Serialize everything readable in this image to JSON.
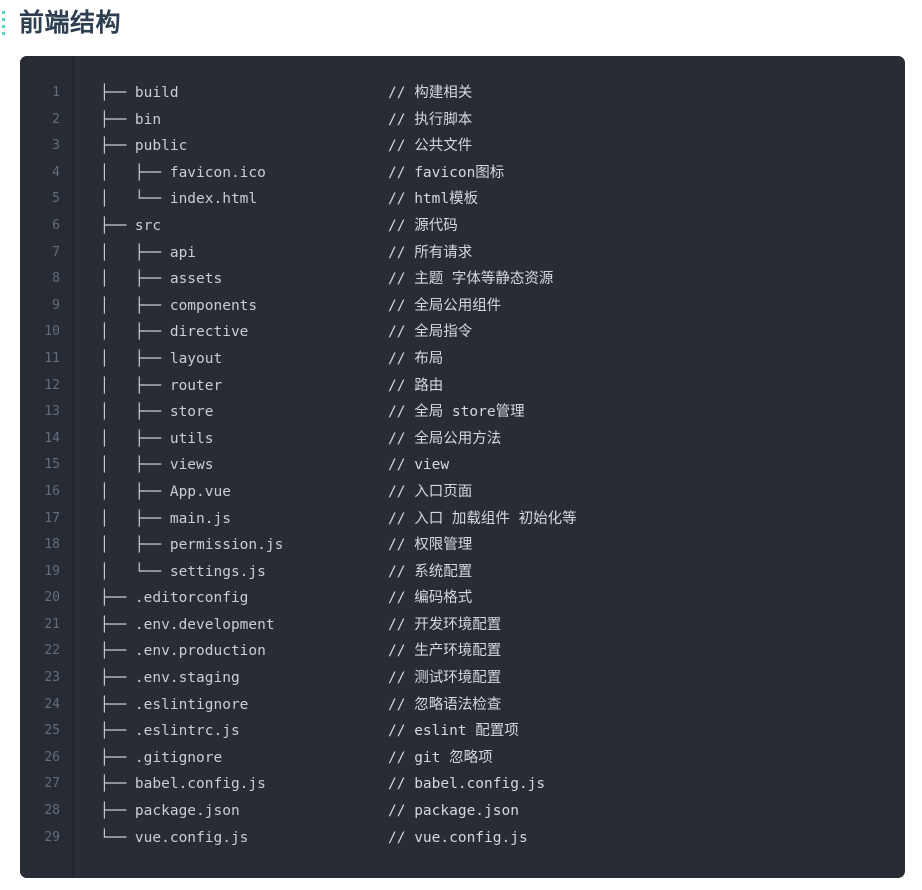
{
  "heading": {
    "title": "前端结构",
    "anchor_marker": "anchor-dots"
  },
  "colors": {
    "page_background": "#ffffff",
    "heading_text": "#2c3e50",
    "code_background": "#282c34",
    "gutter_background": "#272b33",
    "gutter_divider": "#21242b",
    "line_number": "#636d7d",
    "code_text": "#c8cdd6",
    "comment_text": "#d3d8e0",
    "anchor_marker": "#3ec9c9"
  },
  "code_block": {
    "language": "text",
    "total_lines": 29,
    "lines": [
      {
        "n": "1",
        "tree": "├── build",
        "comment": "// 构建相关"
      },
      {
        "n": "2",
        "tree": "├── bin",
        "comment": "// 执行脚本"
      },
      {
        "n": "3",
        "tree": "├── public",
        "comment": "// 公共文件"
      },
      {
        "n": "4",
        "tree": "│   ├── favicon.ico",
        "comment": "// favicon图标"
      },
      {
        "n": "5",
        "tree": "│   └── index.html",
        "comment": "// html模板"
      },
      {
        "n": "6",
        "tree": "├── src",
        "comment": "// 源代码"
      },
      {
        "n": "7",
        "tree": "│   ├── api",
        "comment": "// 所有请求"
      },
      {
        "n": "8",
        "tree": "│   ├── assets",
        "comment": "// 主题 字体等静态资源"
      },
      {
        "n": "9",
        "tree": "│   ├── components",
        "comment": "// 全局公用组件"
      },
      {
        "n": "10",
        "tree": "│   ├── directive",
        "comment": "// 全局指令"
      },
      {
        "n": "11",
        "tree": "│   ├── layout",
        "comment": "// 布局"
      },
      {
        "n": "12",
        "tree": "│   ├── router",
        "comment": "// 路由"
      },
      {
        "n": "13",
        "tree": "│   ├── store",
        "comment": "// 全局 store管理"
      },
      {
        "n": "14",
        "tree": "│   ├── utils",
        "comment": "// 全局公用方法"
      },
      {
        "n": "15",
        "tree": "│   ├── views",
        "comment": "// view"
      },
      {
        "n": "16",
        "tree": "│   ├── App.vue",
        "comment": "// 入口页面"
      },
      {
        "n": "17",
        "tree": "│   ├── main.js",
        "comment": "// 入口 加载组件 初始化等"
      },
      {
        "n": "18",
        "tree": "│   ├── permission.js",
        "comment": "// 权限管理"
      },
      {
        "n": "19",
        "tree": "│   └── settings.js",
        "comment": "// 系统配置"
      },
      {
        "n": "20",
        "tree": "├── .editorconfig",
        "comment": "// 编码格式"
      },
      {
        "n": "21",
        "tree": "├── .env.development",
        "comment": "// 开发环境配置"
      },
      {
        "n": "22",
        "tree": "├── .env.production",
        "comment": "// 生产环境配置"
      },
      {
        "n": "23",
        "tree": "├── .env.staging",
        "comment": "// 测试环境配置"
      },
      {
        "n": "24",
        "tree": "├── .eslintignore",
        "comment": "// 忽略语法检查"
      },
      {
        "n": "25",
        "tree": "├── .eslintrc.js",
        "comment": "// eslint 配置项"
      },
      {
        "n": "26",
        "tree": "├── .gitignore",
        "comment": "// git 忽略项"
      },
      {
        "n": "27",
        "tree": "├── babel.config.js",
        "comment": "// babel.config.js"
      },
      {
        "n": "28",
        "tree": "├── package.json",
        "comment": "// package.json"
      },
      {
        "n": "29",
        "tree": "└── vue.config.js",
        "comment": "// vue.config.js"
      }
    ]
  }
}
